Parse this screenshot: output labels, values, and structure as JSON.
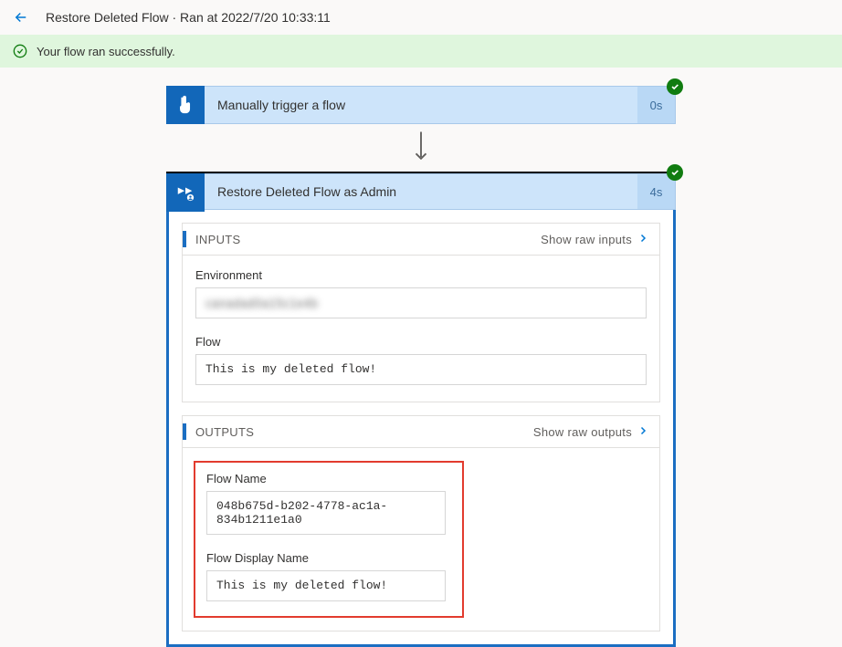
{
  "header": {
    "title": "Restore Deleted Flow · Ran at 2022/7/20 10:33:11"
  },
  "statusBar": {
    "message": "Your flow ran successfully."
  },
  "steps": {
    "trigger": {
      "title": "Manually trigger a flow",
      "duration": "0s"
    },
    "action": {
      "title": "Restore Deleted Flow as Admin",
      "duration": "4s",
      "inputs": {
        "sectionLabel": "INPUTS",
        "rawLink": "Show raw inputs",
        "fields": {
          "environment": {
            "label": "Environment",
            "value": "canadad0a15c1e4b"
          },
          "flow": {
            "label": "Flow",
            "value": "This is my deleted flow!"
          }
        }
      },
      "outputs": {
        "sectionLabel": "OUTPUTS",
        "rawLink": "Show raw outputs",
        "fields": {
          "flowName": {
            "label": "Flow Name",
            "value": "048b675d-b202-4778-ac1a-834b1211e1a0"
          },
          "flowDisplayName": {
            "label": "Flow Display Name",
            "value": "This is my deleted flow!"
          }
        }
      }
    }
  }
}
